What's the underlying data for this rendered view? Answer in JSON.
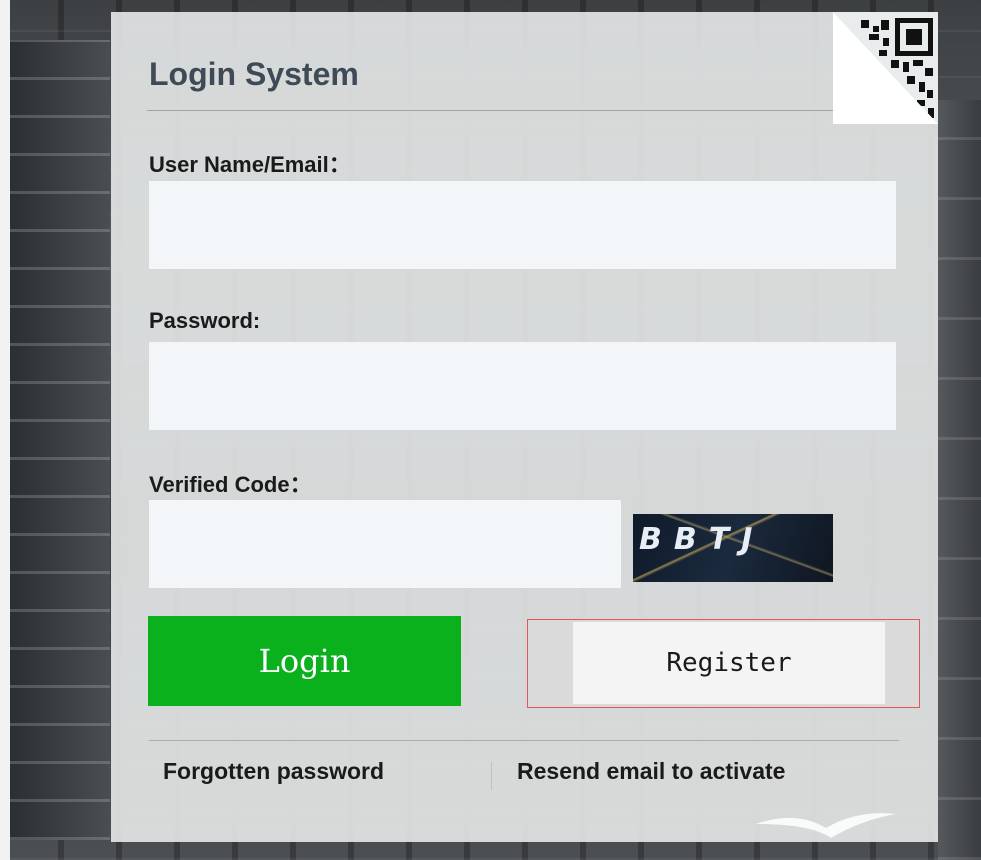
{
  "login_panel": {
    "title": "Login System",
    "username_label": "User Name/Email：",
    "username_value": "",
    "password_label": "Password:",
    "password_value": "",
    "code_label": "Verified Code：",
    "code_value": "",
    "captcha_text": "BBTJ",
    "login_button": "Login",
    "register_button": "Register",
    "forgot_link": "Forgotten password",
    "resend_link": "Resend email to activate"
  },
  "colors": {
    "login_button": "#0bb11d",
    "register_outline": "#e2565a",
    "input_background": "#f3f6f9",
    "title_text": "#3e4a55"
  },
  "icons": [
    "qr-code-icon",
    "bird-logo-icon"
  ]
}
